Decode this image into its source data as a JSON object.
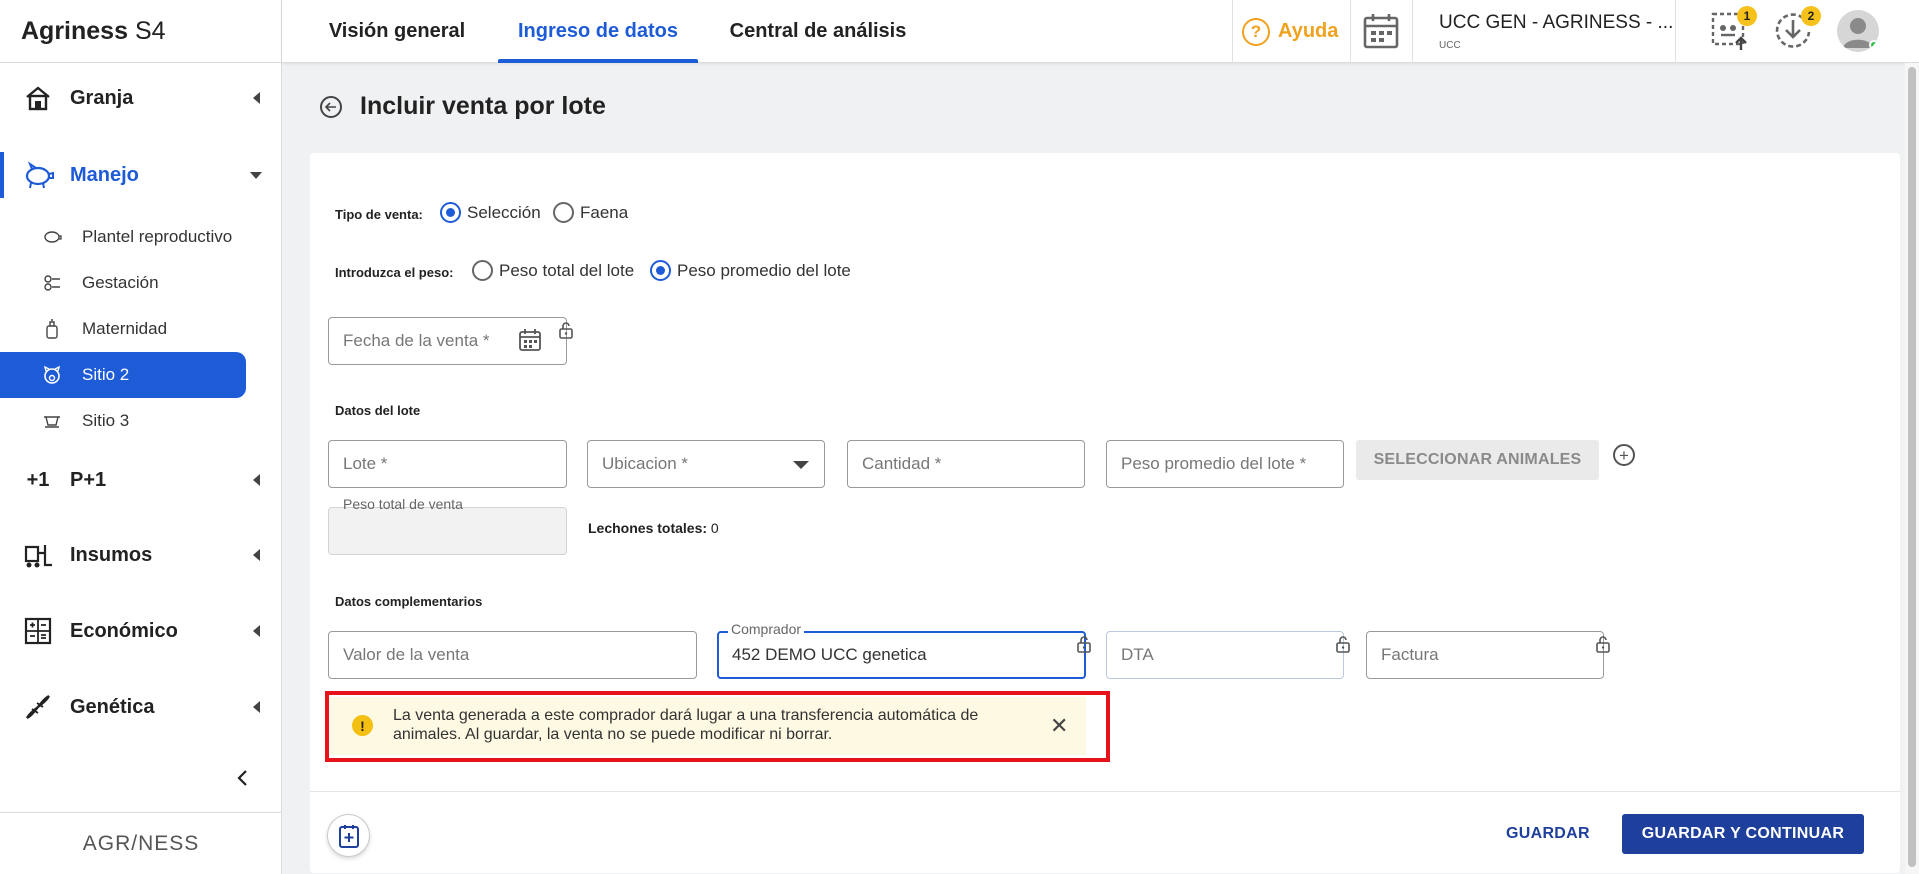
{
  "app": {
    "brand_bold": "Agriness",
    "brand_rest": "S4",
    "footer_logo": "AGR/NESS"
  },
  "sidebar": {
    "items": [
      {
        "label": "Granja"
      },
      {
        "label": "Manejo"
      },
      {
        "label": "P+1"
      },
      {
        "label": "Insumos"
      },
      {
        "label": "Económico"
      },
      {
        "label": "Genética"
      }
    ],
    "subitems": [
      {
        "label": "Plantel reproductivo"
      },
      {
        "label": "Gestación"
      },
      {
        "label": "Maternidad"
      },
      {
        "label": "Sitio 2"
      },
      {
        "label": "Sitio 3"
      }
    ],
    "p1_icon_text": "+1"
  },
  "topbar": {
    "tabs": [
      {
        "label": "Visión general"
      },
      {
        "label": "Ingreso de datos"
      },
      {
        "label": "Central de análisis"
      }
    ],
    "help_label": "Ayuda",
    "help_symbol": "?",
    "farm_name": "UCC GEN - AGRINESS - ...",
    "farm_sub": "UCC",
    "badge_tasks": "1",
    "badge_downloads": "2"
  },
  "page": {
    "title": "Incluir venta por lote",
    "tipo_venta_label": "Tipo de venta:",
    "tipo_venta_options": [
      {
        "label": "Selección",
        "selected": true
      },
      {
        "label": "Faena",
        "selected": false
      }
    ],
    "peso_label": "Introduzca el peso:",
    "peso_options": [
      {
        "label": "Peso total del lote",
        "selected": false
      },
      {
        "label": "Peso promedio del lote",
        "selected": true
      }
    ],
    "fecha_placeholder": "Fecha de la venta *",
    "datos_lote_title": "Datos del lote",
    "lote_placeholder": "Lote *",
    "ubicacion_placeholder": "Ubicacion *",
    "cantidad_placeholder": "Cantidad *",
    "peso_promedio_placeholder": "Peso promedio del lote *",
    "seleccionar_animales": "SELECCIONAR ANIMALES",
    "add_symbol": "+",
    "peso_total_venta_label": "Peso total de venta",
    "lechones_label": "Lechones totales:",
    "lechones_value": "0",
    "datos_complementarios_title": "Datos complementarios",
    "valor_placeholder": "Valor de la venta",
    "comprador_label": "Comprador",
    "comprador_value": "452 DEMO UCC genetica",
    "dta_placeholder": "DTA",
    "factura_placeholder": "Factura",
    "alert_symbol": "!",
    "alert_text": "La venta generada a este comprador dará lugar a una transferencia automática de animales. Al guardar, la venta no se puede modificar ni borrar.",
    "alert_close_symbol": "✕",
    "btn_guardar": "GUARDAR",
    "btn_guardar_continuar": "GUARDAR Y CONTINUAR"
  },
  "colors": {
    "primary": "#1e5bd6",
    "dark_primary": "#1e3f9c",
    "help": "#f0a21e",
    "alert_border": "#e8121b",
    "alert_bg": "#fdf9e3",
    "badge": "#f6c11b"
  }
}
